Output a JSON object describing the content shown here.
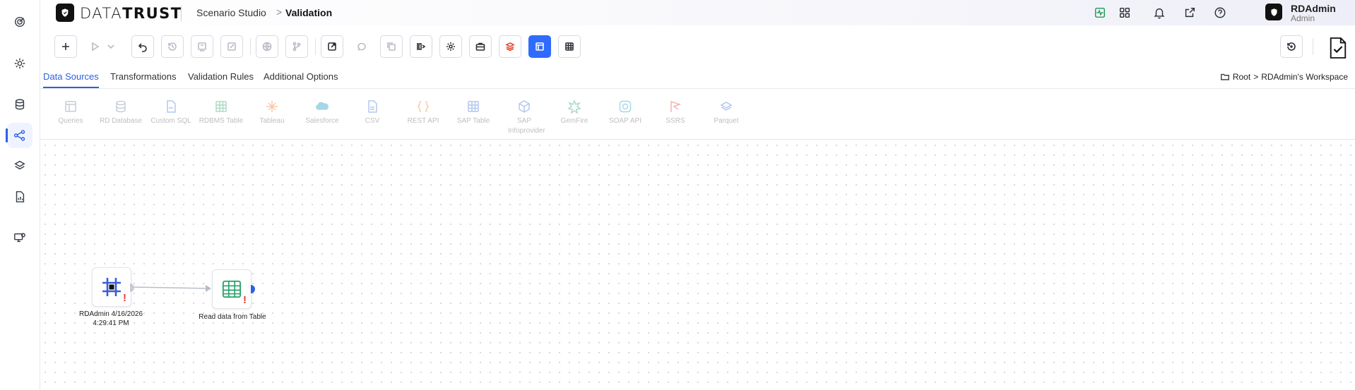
{
  "header": {
    "brand": {
      "part1": "DATA",
      "part2": "TRUST"
    },
    "breadcrumb": {
      "parent": "Scenario Studio",
      "separator": ">",
      "current": "Validation"
    },
    "user": {
      "name": "RDAdmin",
      "role": "Admin"
    }
  },
  "tabs": [
    {
      "label": "Data Sources",
      "active": true
    },
    {
      "label": "Transformations",
      "active": false
    },
    {
      "label": "Validation Rules",
      "active": false
    },
    {
      "label": "Additional Options",
      "active": false
    }
  ],
  "workspace_path": {
    "root": "Root",
    "separator": ">",
    "workspace": "RDAdmin's Workspace"
  },
  "palette": [
    {
      "label": "Queries",
      "icon": "queries-icon",
      "color": "#6b7a99"
    },
    {
      "label": "RD Database",
      "icon": "database-icon",
      "color": "#6b7a99"
    },
    {
      "label": "Custom SQL",
      "icon": "sql-file-icon",
      "color": "#3b6fd8"
    },
    {
      "label": "RDBMS Table",
      "icon": "table-icon",
      "color": "#2aa36b"
    },
    {
      "label": "Tableau",
      "icon": "tableau-icon",
      "color": "#e8762d"
    },
    {
      "label": "Salesforce",
      "icon": "salesforce-cloud-icon",
      "color": "#1798c1"
    },
    {
      "label": "CSV",
      "icon": "csv-file-icon",
      "color": "#3b6fd8"
    },
    {
      "label": "REST API",
      "icon": "braces-icon",
      "color": "#e8762d"
    },
    {
      "label": "SAP Table",
      "icon": "table-icon",
      "color": "#3b6fd8"
    },
    {
      "label": "SAP Infoprovider",
      "icon": "cube-icon",
      "color": "#3b6fd8"
    },
    {
      "label": "GemFire",
      "icon": "gemfire-icon",
      "color": "#2aa36b"
    },
    {
      "label": "SOAP API",
      "icon": "soap-icon",
      "color": "#1798c1"
    },
    {
      "label": "SSRS",
      "icon": "ssrs-icon",
      "color": "#e53935"
    },
    {
      "label": "Parquet",
      "icon": "parquet-icon",
      "color": "#3b6fd8"
    }
  ],
  "nodes": [
    {
      "label": "RDAdmin 4/16/2026 4:29:41 PM",
      "icon": "query-node-icon",
      "status": "!"
    },
    {
      "label": "Read data from Table",
      "icon": "table-node-icon",
      "status": "!"
    }
  ],
  "colors": {
    "accent": "#2f5fe0",
    "warning": "#e53935",
    "table_green": "#2aa36b"
  }
}
